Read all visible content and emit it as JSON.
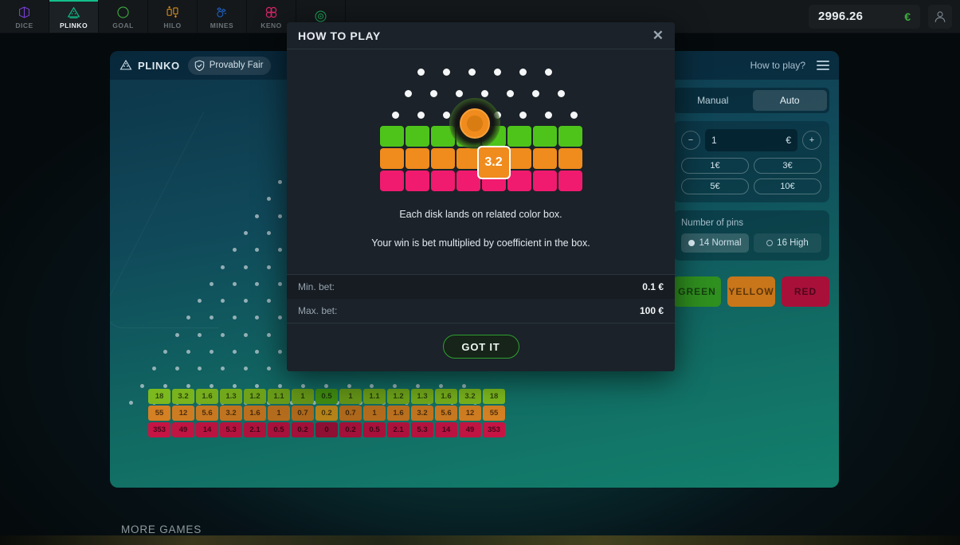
{
  "topnav": {
    "games": [
      {
        "label": "DICE",
        "icon": "dice-icon",
        "color": "#7b3fd4",
        "active": false
      },
      {
        "label": "PLINKO",
        "icon": "plinko-icon",
        "color": "#12c08b",
        "active": true
      },
      {
        "label": "GOAL",
        "icon": "goal-icon",
        "color": "#3fae3f",
        "active": false
      },
      {
        "label": "HILO",
        "icon": "hilo-icon",
        "color": "#d98c1a",
        "active": false
      },
      {
        "label": "MINES",
        "icon": "mines-icon",
        "color": "#1f63c4",
        "active": false
      },
      {
        "label": "KENO",
        "icon": "keno-icon",
        "color": "#d6256a",
        "active": false
      },
      {
        "label": "",
        "icon": "target-icon",
        "color": "#1d9e55",
        "active": false
      }
    ],
    "balance": "2996.26",
    "currency": "€",
    "avatar": "user-avatar-icon"
  },
  "game": {
    "title": "PLINKO",
    "provably_fair": "Provably Fair",
    "how_to_play": "How to play?",
    "menu": "hamburger-menu-icon"
  },
  "panel": {
    "mode_manual": "Manual",
    "mode_auto": "Auto",
    "bet_value": "1",
    "chips": [
      "1€",
      "3€",
      "5€",
      "10€"
    ],
    "pins_label": "Number of pins",
    "pins_options": [
      {
        "label": "14 Normal",
        "selected": true
      },
      {
        "label": "16 High",
        "selected": false
      }
    ],
    "color_buttons": [
      {
        "label": "GREEN",
        "color": "#2f8f1f"
      },
      {
        "label": "YELLOW",
        "color": "#c9761a"
      },
      {
        "label": "RED",
        "color": "#a8103a"
      }
    ]
  },
  "multipliers": {
    "green": [
      "18",
      "3.2",
      "1.6",
      "1.3",
      "1.2",
      "1.1",
      "1",
      "0.5",
      "1",
      "1.1",
      "1.2",
      "1.3",
      "1.6",
      "3.2",
      "18"
    ],
    "yellow": [
      "55",
      "12",
      "5.6",
      "3.2",
      "1.6",
      "1",
      "0.7",
      "0.2",
      "0.7",
      "1",
      "1.6",
      "3.2",
      "5.6",
      "12",
      "55"
    ],
    "red": [
      "353",
      "49",
      "14",
      "5.3",
      "2.1",
      "0.5",
      "0.2",
      "0",
      "0.2",
      "0.5",
      "2.1",
      "5.3",
      "14",
      "49",
      "353"
    ],
    "green_color": "#7ab51d",
    "green_center_color": "#3f8c12",
    "yellow_color": "#d07d22",
    "yellow_center_color": "#b5831a",
    "red_color": "#c21444",
    "red_center_color": "#8e0f34"
  },
  "footer": {
    "more_games": "MORE GAMES"
  },
  "modal": {
    "title": "HOW TO PLAY",
    "close": "close-icon",
    "line1": "Each disk lands on related color box.",
    "line2": "Your win is bet multiplied by coefficient in the box.",
    "chip_value": "3.2",
    "rows": [
      {
        "key": "Min. bet:",
        "value": "0.1 €"
      },
      {
        "key": "Max. bet:",
        "value": "100 €"
      }
    ],
    "button": "GOT IT",
    "demo": {
      "pin_rows": [
        6,
        7,
        8
      ],
      "box_colors": [
        "#4ec41a",
        "#f08b1d",
        "#f01a6e"
      ],
      "box_count": 8
    }
  }
}
